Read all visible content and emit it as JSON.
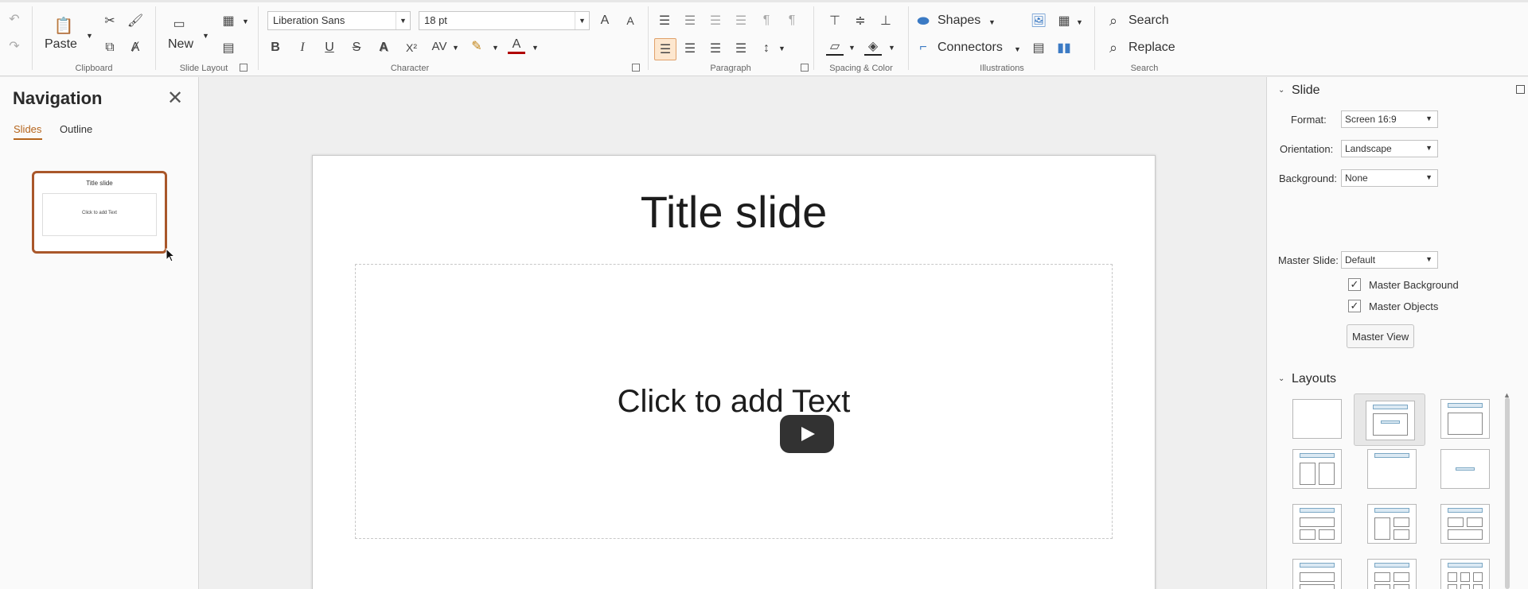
{
  "ribbon": {
    "clipboard": {
      "paste_label": "Paste",
      "group_label": "Clipboard"
    },
    "slide_layout": {
      "new_label": "New",
      "group_label": "Slide Layout"
    },
    "character": {
      "font_name": "Liberation Sans",
      "font_size": "18 pt",
      "group_label": "Character",
      "bold": "B",
      "italic": "I",
      "underline": "U",
      "strike": "S",
      "shadow": "A",
      "superscript": "X²",
      "spacing": "AV",
      "font_color": "A"
    },
    "paragraph": {
      "group_label": "Paragraph"
    },
    "spacing_color": {
      "group_label": "Spacing & Color"
    },
    "illustrations": {
      "shapes_label": "Shapes",
      "connectors_label": "Connectors",
      "group_label": "Illustrations"
    },
    "search": {
      "search_label": "Search",
      "replace_label": "Replace",
      "group_label": "Search"
    }
  },
  "navigation": {
    "title": "Navigation",
    "tabs": [
      "Slides",
      "Outline"
    ],
    "thumbnail": {
      "title": "Title slide",
      "body": "Click to add Text"
    }
  },
  "slide": {
    "title": "Title slide",
    "body": "Click to add Text"
  },
  "sidebar": {
    "slide_section": {
      "title": "Slide",
      "format_label": "Format:",
      "format_value": "Screen 16:9",
      "orientation_label": "Orientation:",
      "orientation_value": "Landscape",
      "background_label": "Background:",
      "background_value": "None",
      "master_slide_label": "Master Slide:",
      "master_slide_value": "Default",
      "master_background_label": "Master Background",
      "master_objects_label": "Master Objects",
      "master_view_label": "Master View"
    },
    "layouts_section": {
      "title": "Layouts"
    }
  },
  "colors": {
    "accent": "#b5651d",
    "thumb_border": "#a9572a"
  }
}
